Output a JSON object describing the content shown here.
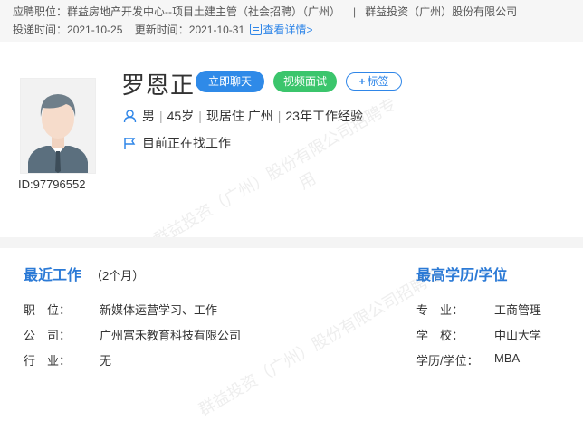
{
  "header": {
    "position_label": "应聘职位：",
    "position_value": "群益房地产开发中心--项目土建主管（社会招聘）（广州）",
    "separator": "|",
    "company": "群益投资（广州）股份有限公司",
    "submit_label": "投递时间：",
    "submit_date": "2021-10-25",
    "update_label": "更新时间：",
    "update_date": "2021-10-31",
    "detail_link": "查看详情>"
  },
  "profile": {
    "name": "罗恩正",
    "chat_button": "立即聊天",
    "video_button": "视频面试",
    "tag_button": "标签",
    "gender": "男",
    "age": "45岁",
    "residence": "现居住 广州",
    "experience": "23年工作经验",
    "divider": "|",
    "status": "目前正在找工作",
    "candidate_id": "ID:97796552"
  },
  "watermark": {
    "line1": "群益投资（广州）股份有限公司招聘专",
    "line2": "用"
  },
  "recent_work": {
    "title": "最近工作",
    "duration": "（2个月）",
    "rows": [
      {
        "label": "职　位：",
        "value": "新媒体运营学习、工作"
      },
      {
        "label": "公　司：",
        "value": "广州富禾教育科技有限公司"
      },
      {
        "label": "行　业：",
        "value": "无"
      }
    ]
  },
  "education": {
    "title": "最高学历/学位",
    "rows": [
      {
        "label": "专　业：",
        "value": "工商管理"
      },
      {
        "label": "学　校：",
        "value": "中山大学"
      },
      {
        "label": "学历/学位：",
        "value": "MBA"
      }
    ]
  },
  "colors": {
    "accent": "#2f8ae8",
    "video_green": "#3bc56c",
    "section_title": "#2b7ad6"
  }
}
